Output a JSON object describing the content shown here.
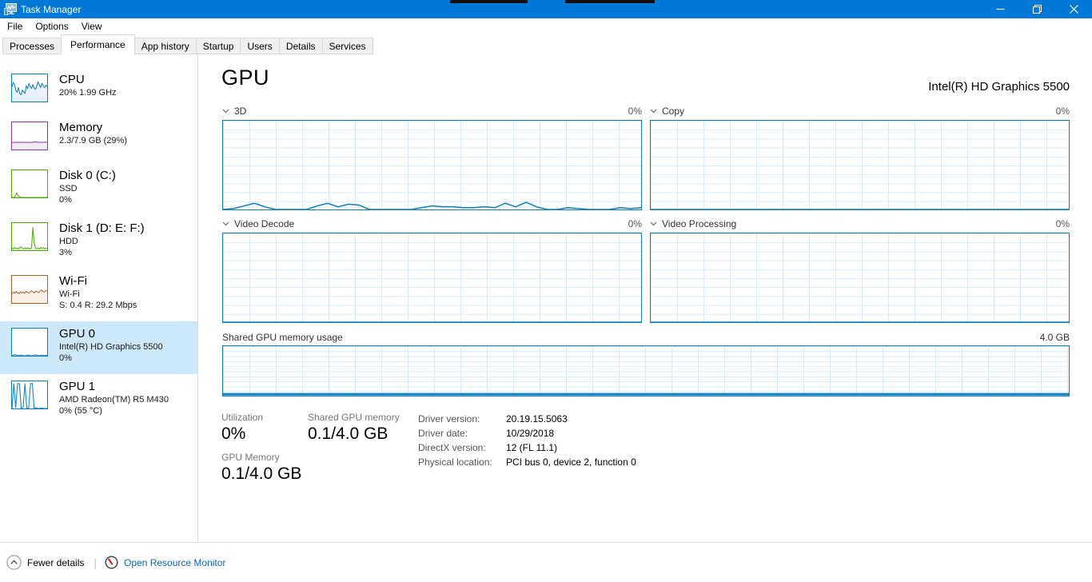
{
  "window": {
    "title": "Task Manager"
  },
  "menu": {
    "items": [
      "File",
      "Options",
      "View"
    ]
  },
  "tabs": {
    "items": [
      "Processes",
      "Performance",
      "App history",
      "Startup",
      "Users",
      "Details",
      "Services"
    ],
    "selected": "Performance"
  },
  "sidebar": {
    "items": [
      {
        "title": "CPU",
        "line2": "20% 1.99 GHz",
        "line3": ""
      },
      {
        "title": "Memory",
        "line2": "2.3/7.9 GB (29%)",
        "line3": ""
      },
      {
        "title": "Disk 0 (C:)",
        "line2": "SSD",
        "line3": "0%"
      },
      {
        "title": "Disk 1 (D: E: F:)",
        "line2": "HDD",
        "line3": "3%"
      },
      {
        "title": "Wi-Fi",
        "line2": "Wi-Fi",
        "line3": "S: 0.4 R: 29.2 Mbps"
      },
      {
        "title": "GPU 0",
        "line2": "Intel(R) HD Graphics 5500",
        "line3": "0%"
      },
      {
        "title": "GPU 1",
        "line2": "AMD Radeon(TM) R5 M430",
        "line3": "0% (55 °C)"
      }
    ]
  },
  "main": {
    "title": "GPU",
    "device": "Intel(R) HD Graphics 5500",
    "engine_charts": [
      {
        "label": "3D",
        "value": "0%"
      },
      {
        "label": "Copy",
        "value": "0%"
      },
      {
        "label": "Video Decode",
        "value": "0%"
      },
      {
        "label": "Video Processing",
        "value": "0%"
      }
    ],
    "shared_chart": {
      "label": "Shared GPU memory usage",
      "max": "4.0 GB"
    },
    "stats": {
      "utilization": {
        "label": "Utilization",
        "value": "0%"
      },
      "gpu_memory": {
        "label": "GPU Memory",
        "value": "0.1/4.0 GB"
      },
      "shared_gpu_memory": {
        "label": "Shared GPU memory",
        "value": "0.1/4.0 GB"
      },
      "details": [
        {
          "label": "Driver version:",
          "value": "20.19.15.5063"
        },
        {
          "label": "Driver date:",
          "value": "10/29/2018"
        },
        {
          "label": "DirectX version:",
          "value": "12 (FL 11.1)"
        },
        {
          "label": "Physical location:",
          "value": "PCI bus 0, device 2, function 0"
        }
      ]
    }
  },
  "footer": {
    "fewer_details": "Fewer details",
    "resource_monitor": "Open Resource Monitor"
  },
  "colors": {
    "titlebar": "#0078d7",
    "accent_blue": "#117dbb",
    "grid": "#d9e9f7",
    "memory_purple": "#8f33ad",
    "disk_green": "#4da60c",
    "wifi_orange": "#a9632a",
    "selected_bg": "#cde9f9",
    "link_blue": "#0066cc"
  },
  "chart_data": {
    "type": "area",
    "ylim": [
      0,
      100
    ],
    "grid": true,
    "series": {
      "cpu": {
        "name": "CPU utilization %",
        "color": "#117dbb",
        "fill": "#e9f2fa",
        "stroke": 1,
        "values": [
          55,
          70,
          62,
          40,
          35,
          52,
          28,
          25,
          42,
          35,
          30,
          58,
          48,
          66,
          55,
          48,
          62,
          50,
          45,
          58,
          72,
          60,
          52,
          66,
          58,
          52,
          60,
          56
        ]
      },
      "memory": {
        "name": "Memory usage (29%)",
        "color": "#8f33ad",
        "fill": "#f3ecf7",
        "stroke": 1,
        "values": [
          26,
          26,
          27,
          26,
          27,
          26,
          26,
          28,
          27,
          26,
          27,
          27
        ]
      },
      "disk0": {
        "name": "Disk 0 active time %",
        "color": "#4da60c",
        "fill": "#eef7e7",
        "stroke": 1,
        "values": [
          0,
          0,
          3,
          16,
          6,
          2,
          0,
          0,
          0,
          0,
          0,
          0,
          0,
          0,
          0,
          0,
          0,
          0,
          0,
          0,
          0,
          0,
          0,
          0
        ]
      },
      "disk1": {
        "name": "Disk 1 active time %",
        "color": "#4da60c",
        "fill": "#eef7e7",
        "stroke": 1,
        "values": [
          8,
          4,
          10,
          6,
          8,
          5,
          9,
          12,
          7,
          5,
          9,
          6,
          8,
          7,
          5,
          9,
          84,
          30,
          9,
          6,
          8,
          5,
          10,
          7,
          9,
          5,
          8,
          7
        ]
      },
      "wifi": {
        "name": "Wi-Fi throughput",
        "color": "#a9632a",
        "fill": "#f9f1e8",
        "stroke": 1,
        "values": [
          34,
          40,
          36,
          42,
          38,
          34,
          41,
          37,
          40,
          36,
          43,
          39,
          36,
          42,
          45,
          40,
          37,
          44,
          41,
          38,
          45,
          48,
          42,
          40,
          46,
          44
        ]
      },
      "gpu0": {
        "name": "GPU 0 utilization %",
        "color": "#117dbb",
        "fill": "#eff7fc",
        "stroke": 1,
        "values": [
          0,
          3,
          4,
          2,
          0,
          3,
          2,
          0,
          0,
          2,
          3,
          0,
          0,
          2,
          4,
          2,
          0,
          1,
          3,
          0,
          2,
          1
        ]
      },
      "gpu1": {
        "name": "GPU 1 utilization %",
        "color": "#117dbb",
        "fill": "#eff7fc",
        "stroke": 1,
        "values": [
          0,
          92,
          3,
          92,
          92,
          0,
          4,
          92,
          0,
          2,
          92,
          92,
          0,
          3,
          0,
          0,
          2,
          0,
          0,
          0
        ]
      },
      "gpu_3d": {
        "name": "GPU engine 3D %",
        "color": "#117dbb",
        "fill": "#eff7fc",
        "stroke": 1.5,
        "values": [
          0,
          1,
          4,
          7,
          3,
          0,
          0,
          0,
          0,
          4,
          7,
          3,
          6,
          5,
          0,
          0,
          0,
          0,
          0,
          2,
          4,
          3,
          3,
          2,
          2,
          3,
          2,
          7,
          3,
          8,
          3,
          0,
          0,
          2,
          1,
          0,
          0,
          0,
          2,
          1,
          2
        ]
      },
      "gpu_copy": {
        "name": "GPU engine Copy %",
        "color": "#117dbb",
        "fill": "#eff7fc",
        "stroke": 1.5,
        "values": [
          0,
          0
        ]
      },
      "gpu_video_decode": {
        "name": "GPU engine Video Decode %",
        "color": "#117dbb",
        "fill": "#eff7fc",
        "stroke": 1.5,
        "values": [
          0,
          0
        ]
      },
      "gpu_video_processing": {
        "name": "GPU engine Video Processing %",
        "color": "#117dbb",
        "fill": "#eff7fc",
        "stroke": 1.5,
        "values": [
          0,
          0
        ]
      },
      "shared_memory": {
        "name": "Shared GPU memory usage (0.1 of 4.0 GB)",
        "color": "#117dbb",
        "fill": "#eff7fc",
        "stroke": 3,
        "values": [
          3,
          3
        ]
      }
    }
  }
}
